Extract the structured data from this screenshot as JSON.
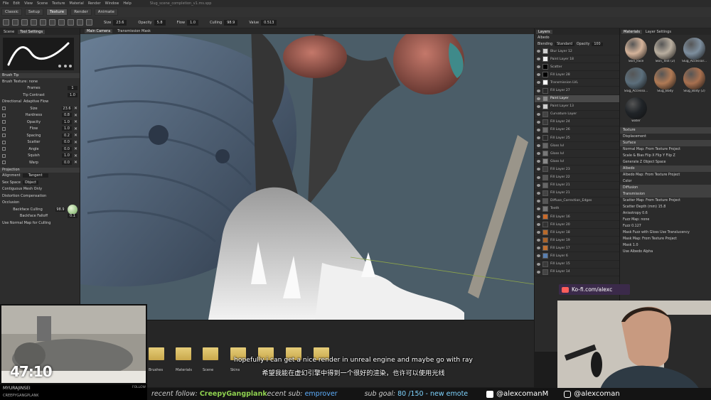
{
  "app": {
    "menus": [
      "File",
      "Edit",
      "View",
      "Scene",
      "Texture",
      "Material",
      "Render",
      "Window",
      "Help"
    ],
    "title": "Slug_scene_completion_v1.ms.spp",
    "mode_tabs": [
      "Classic",
      "Setup",
      "Texture",
      "Render",
      "Animate"
    ],
    "active_mode": "Texture"
  },
  "toolbar": {
    "size_label": "Size",
    "size_value": "23.6",
    "opacity_label": "Opacity",
    "opacity_value": "5.8",
    "flow_label": "Flow",
    "flow_value": "1.0",
    "culling_label": "Culling",
    "culling_value": "98.9",
    "value_label": "Value",
    "value_value": "0.513"
  },
  "left_panel": {
    "tabs": [
      "Scene",
      "Tool Settings"
    ],
    "active_tab": "Tool Settings",
    "brush_tip_header": "Brush Tip",
    "brush_texture": "Brush Texture: none",
    "frames_label": "Frames",
    "frames_value": "1",
    "tip_contrast_label": "Tip Contrast",
    "tip_contrast_value": "1.0",
    "directional": "Directional",
    "adaptive_flow": "Adaptive Flow",
    "params": [
      {
        "label": "Size",
        "value": "23.6"
      },
      {
        "label": "Hardness",
        "value": "0.8"
      },
      {
        "label": "Opacity",
        "value": "1.0"
      },
      {
        "label": "Flow",
        "value": "1.0"
      },
      {
        "label": "Spacing",
        "value": "0.2"
      },
      {
        "label": "Scatter",
        "value": "0.0"
      },
      {
        "label": "Angle",
        "value": "0.0"
      },
      {
        "label": "Squish",
        "value": "1.0"
      },
      {
        "label": "Warp",
        "value": "0.0"
      }
    ],
    "projection_header": "Projection",
    "alignment_label": "Alignment",
    "alignment_value": "Tangent",
    "sex_space_label": "Sex Space",
    "sex_space_value": "Object",
    "contiguous": "Contiguous Mesh Only",
    "distortion": "Distortion Compensation",
    "occlusion": "Occlusion",
    "backface_culling_label": "Backface Culling",
    "backface_culling_value": "98.9",
    "backface_falloff_label": "Backface Falloff",
    "backface_falloff_value": "0.1",
    "normal_map": "Use Normal Map for Culling"
  },
  "viewport": {
    "tabs": [
      "Main Camera",
      "Transmission Mask"
    ],
    "active_tab": "Main Camera"
  },
  "layers": {
    "title": "Layers",
    "channel": "Albedo",
    "blending_label": "Blending",
    "blending_value": "Standard",
    "opacity_label": "Opacity",
    "opacity_value": "100",
    "items": [
      {
        "name": "Blur Layer 12",
        "color": "#cfcfcf"
      },
      {
        "name": "Paint Layer 18",
        "color": "#eeeeee"
      },
      {
        "name": "Scatter",
        "color": "#000000"
      },
      {
        "name": "Fill Layer 28",
        "color": "#000000"
      },
      {
        "name": "Transmission LVL",
        "color": "#ffffff"
      },
      {
        "name": "Fill Layer 27",
        "color": "#2a2a2a"
      },
      {
        "name": "Paint Layer",
        "color": "#8a8a8a"
      },
      {
        "name": "Paint Layer 13",
        "color": "#cfcfcf"
      },
      {
        "name": "Curvature Layer",
        "color": "#444444"
      },
      {
        "name": "Fill Layer 24",
        "color": "#3a3a3a"
      },
      {
        "name": "Fill Layer 26",
        "color": "#6a6a6a"
      },
      {
        "name": "Fill Layer 25",
        "color": "#2a2a2a"
      },
      {
        "name": "Gloss lvl",
        "color": "#666666"
      },
      {
        "name": "Gloss lvl",
        "color": "#777777"
      },
      {
        "name": "Gloss lvl",
        "color": "#888888"
      },
      {
        "name": "Fill Layer 23",
        "color": "#3f3f3f"
      },
      {
        "name": "Fill Layer 22",
        "color": "#555555"
      },
      {
        "name": "Fill Layer 21",
        "color": "#666666"
      },
      {
        "name": "Fill Layer 21",
        "color": "#444444"
      },
      {
        "name": "Diffuse_Correction_Edges",
        "color": "#555555"
      },
      {
        "name": "Teeth",
        "color": "#777777"
      },
      {
        "name": "Fill Layer 16",
        "color": "#c96a2a"
      },
      {
        "name": "Fill Layer 20",
        "color": "#333333"
      },
      {
        "name": "Fill Layer 18",
        "color": "#b86a2a"
      },
      {
        "name": "Fill Layer 19",
        "color": "#a8632a"
      },
      {
        "name": "Fill Layer 17",
        "color": "#c07030"
      },
      {
        "name": "Fill Layer 6",
        "color": "#5a7fb0"
      },
      {
        "name": "Fill Layer 15",
        "color": "#3a3a3a"
      },
      {
        "name": "Fill Layer 14",
        "color": "#444444"
      }
    ],
    "selected_index": 6
  },
  "materials": {
    "tabs": [
      "Materials",
      "Layer Settings"
    ],
    "active_tab": "Materials",
    "items": [
      {
        "name": "Skin_Face",
        "color": "#d4b39a"
      },
      {
        "name": "Skin_Test (2)",
        "color": "#b9ae9f"
      },
      {
        "name": "Slug_Accessor...",
        "color": "#7d8e9e"
      },
      {
        "name": "Slug_Accesso...",
        "color": "#5c6f7c"
      },
      {
        "name": "Slug_Body",
        "color": "#b07a55"
      },
      {
        "name": "Slug_Body (2)",
        "color": "#a8704f"
      },
      {
        "name": "water",
        "color": "#202428"
      }
    ],
    "props": [
      {
        "text": "Texture",
        "h": true
      },
      {
        "text": "Displacement",
        "h": false
      },
      {
        "text": "Surface",
        "h": true
      },
      {
        "text": "Normal Map: From Texture Project",
        "h": false
      },
      {
        "text": "Scale & Bias   Flip X   Flip Y   Flip Z",
        "h": false
      },
      {
        "text": "Generate Z   Object Space",
        "h": false
      },
      {
        "text": "Albedo",
        "h": true
      },
      {
        "text": "Albedo Map: From Texture Project",
        "h": false
      },
      {
        "text": "Color",
        "h": false
      },
      {
        "text": "Diffusion",
        "h": true
      },
      {
        "text": "Transmission",
        "h": true
      },
      {
        "text": "Scatter Map: From Texture Project",
        "h": false
      },
      {
        "text": "Scatter Depth (mm)   15.8",
        "h": false
      },
      {
        "text": "Anisotropy   0.6",
        "h": false
      },
      {
        "text": "Fuzz Map: none",
        "h": false
      },
      {
        "text": "Fuzz   0.127",
        "h": false
      },
      {
        "text": "Mask Fuzz with Gloss   Use Translucency",
        "h": false
      },
      {
        "text": "Mask Map: From Texture Project",
        "h": false
      },
      {
        "text": "Mask   1.0",
        "h": false
      },
      {
        "text": "Use Albedo Alpha",
        "h": false
      }
    ]
  },
  "shelf": {
    "folders": [
      "Brushes",
      "Materials",
      "Scene",
      "Skins",
      "",
      "",
      ""
    ]
  },
  "stream": {
    "timer": "47:10",
    "cam1_top": "MYURAJINSEI",
    "cam1_bottom": "CREEPYGANGPLANK",
    "follow": "FOLLOW",
    "kofi": "Ko-fi.com/alexc",
    "subtitle_en": "hopefully i can get a nice render in unreal engine and maybe go with ray",
    "subtitle_zh": "希望我能在虚幻引擎中得到一个很好的渲染，也许可以使用光线",
    "recent_follow_label": "recent follow:",
    "recent_follow_name": "CreepyGangplank",
    "recent_sub_label": "ecent sub:",
    "recent_sub_name": "emprover",
    "sub_goal_label": "sub goal:",
    "sub_goal_value": "80",
    "sub_goal_rest": "/150 - new emote",
    "twitter": "@alexcomanM",
    "instagram": "@alexcoman"
  }
}
